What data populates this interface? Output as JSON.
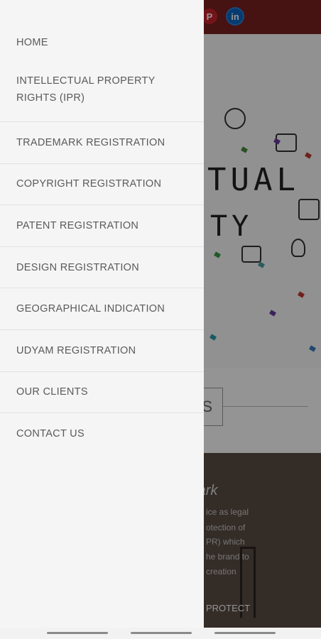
{
  "background": {
    "hero_title_line1": "TUAL",
    "hero_title_line2": "TY",
    "about_button": "ABOUT US",
    "banner_heading": "mark",
    "banner_lines": [
      "ice as legal",
      "otection of",
      "PR) which",
      "he brand to",
      "creation"
    ],
    "protect_label": "PROTECT"
  },
  "menu": {
    "items": [
      {
        "label": "HOME"
      },
      {
        "label": "INTELLECTUAL PROPERTY RIGHTS (IPR)"
      },
      {
        "label": "TRADEMARK REGISTRATION"
      },
      {
        "label": "COPYRIGHT REGISTRATION"
      },
      {
        "label": "PATENT REGISTRATION"
      },
      {
        "label": "DESIGN REGISTRATION"
      },
      {
        "label": "GEOGRAPHICAL INDICATION"
      },
      {
        "label": "UDYAM REGISTRATION"
      },
      {
        "label": "OUR CLIENTS"
      },
      {
        "label": "CONTACT US"
      }
    ]
  },
  "social": {
    "pinterest_icon": "pinterest-icon",
    "pinterest_glyph": "P",
    "linkedin_icon": "linkedin-icon",
    "linkedin_glyph": "in"
  },
  "colors": {
    "topbar": "#7a1f1f",
    "drawer_bg": "#f5f5f5",
    "menu_text": "#5a5a5a"
  }
}
